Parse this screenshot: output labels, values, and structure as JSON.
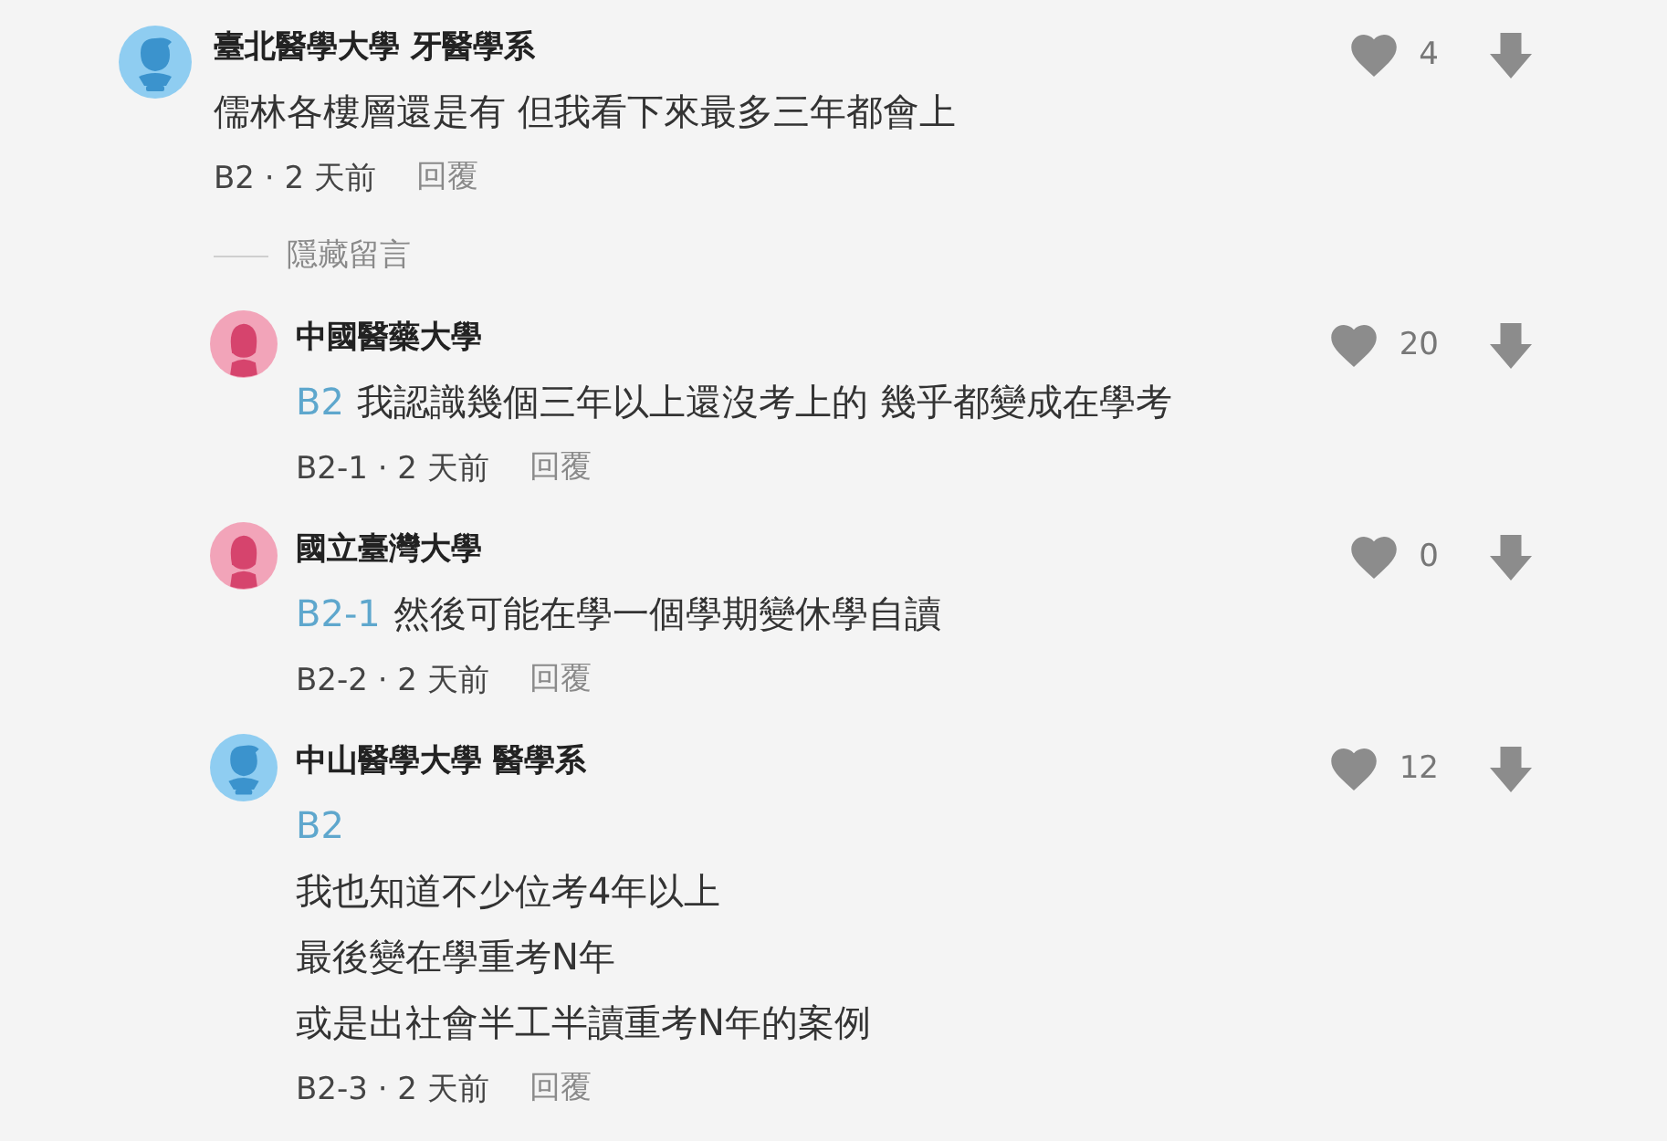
{
  "comment": {
    "avatar": {
      "kind": "male"
    },
    "author": "臺北醫學大學 牙醫學系",
    "lines": [
      {
        "text": "儒林各樓層還是有 但我看下來最多三年都會上"
      }
    ],
    "meta": "B2 · 2 天前",
    "reply_action": "回覆",
    "likes": "4"
  },
  "hide_replies": "隱藏留言",
  "replies": [
    {
      "avatar": {
        "kind": "female"
      },
      "author": "中國醫藥大學",
      "lines": [
        {
          "mention": "B2",
          "text": "我認識幾個三年以上還沒考上的 幾乎都變成在學考"
        }
      ],
      "meta": "B2-1 · 2 天前",
      "reply_action": "回覆",
      "likes": "20"
    },
    {
      "avatar": {
        "kind": "female"
      },
      "author": "國立臺灣大學",
      "lines": [
        {
          "mention": "B2-1",
          "text": "然後可能在學一個學期變休學自讀"
        }
      ],
      "meta": "B2-2 · 2 天前",
      "reply_action": "回覆",
      "likes": "0"
    },
    {
      "avatar": {
        "kind": "male"
      },
      "author": "中山醫學大學 醫學系",
      "lines": [
        {
          "mention": "B2"
        },
        {
          "text": "我也知道不少位考4年以上"
        },
        {
          "text": "最後變在學重考N年"
        },
        {
          "text": "或是出社會半工半讀重考N年的案例"
        }
      ],
      "meta": "B2-3 · 2 天前",
      "reply_action": "回覆",
      "likes": "12"
    }
  ]
}
